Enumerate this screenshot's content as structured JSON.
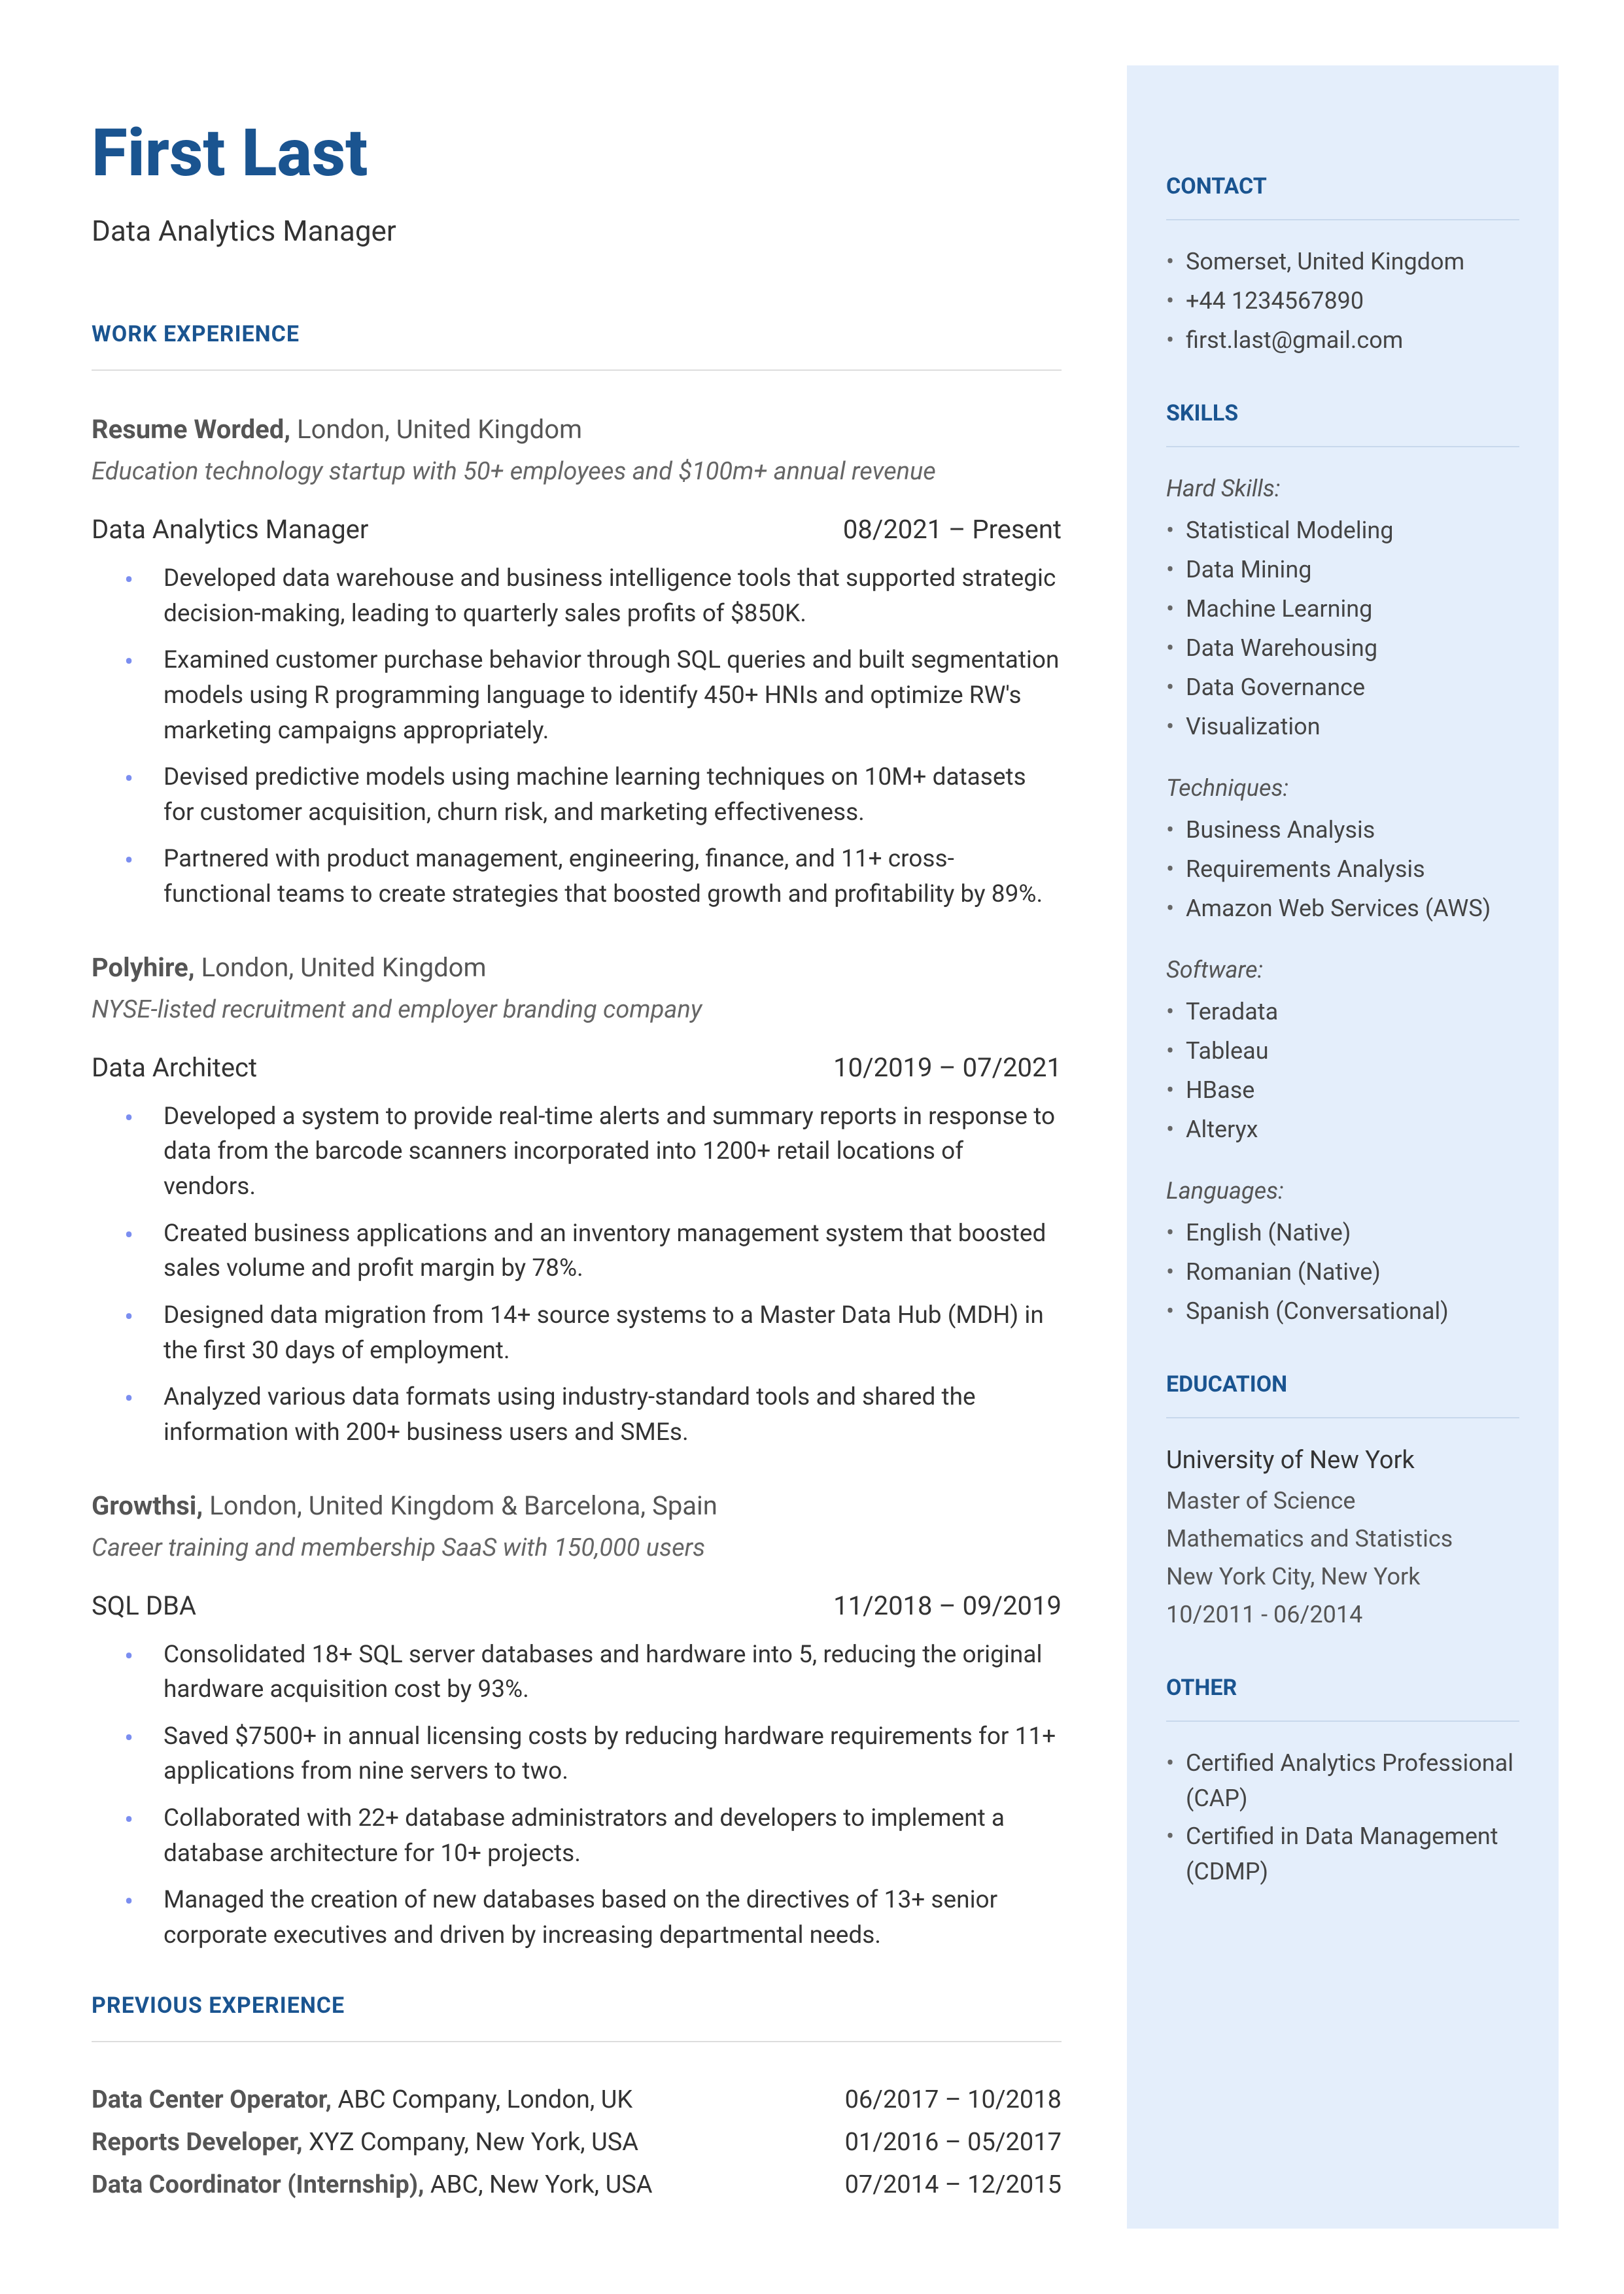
{
  "name": "First Last",
  "title": "Data Analytics Manager",
  "sections": {
    "work_experience": "WORK EXPERIENCE",
    "previous_experience": "PREVIOUS EXPERIENCE",
    "contact": "CONTACT",
    "skills": "SKILLS",
    "education": "EDUCATION",
    "other": "OTHER"
  },
  "jobs": [
    {
      "company": "Resume Worded,",
      "location": " London, United Kingdom",
      "desc": "Education technology startup with 50+ employees and $100m+ annual revenue",
      "role": "Data Analytics Manager",
      "dates": "08/2021 – Present",
      "bullets": [
        "Developed data warehouse and business intelligence tools that supported strategic decision-making, leading to quarterly sales profits of $850K.",
        "Examined customer purchase behavior through SQL queries and built segmentation models using R programming language to identify 450+ HNIs and optimize RW's marketing campaigns appropriately.",
        "Devised predictive models using machine learning techniques on 10M+ datasets for customer acquisition, churn risk, and marketing effectiveness.",
        "Partnered with product management, engineering, finance, and 11+ cross-functional teams to create strategies that boosted growth and profitability by 89%."
      ]
    },
    {
      "company": "Polyhire,",
      "location": " London, United Kingdom",
      "desc": "NYSE-listed recruitment and employer branding company",
      "role": "Data Architect",
      "dates": "10/2019 – 07/2021",
      "bullets": [
        "Developed a system to provide real-time alerts and summary reports in response to data from the barcode scanners incorporated into 1200+ retail locations of vendors.",
        "Created business applications and an inventory management system that boosted sales volume and profit margin by 78%.",
        "Designed data migration from 14+ source systems to a Master Data Hub (MDH) in the first 30 days of employment.",
        "Analyzed various data formats using industry-standard tools and shared the information with 200+ business users and SMEs."
      ]
    },
    {
      "company": "Growthsi,",
      "location": " London, United Kingdom & Barcelona, Spain",
      "desc": "Career training and membership SaaS with 150,000 users",
      "role": "SQL DBA",
      "dates": "11/2018 – 09/2019",
      "bullets": [
        "Consolidated 18+ SQL server databases and hardware into 5, reducing the original hardware acquisition cost by 93%.",
        "Saved $7500+ in annual licensing costs by reducing hardware requirements for 11+ applications from nine servers to two.",
        "Collaborated with 22+ database administrators and developers to implement a database architecture for 10+ projects.",
        "Managed the creation of new databases based on the directives of 13+ senior corporate executives and driven by increasing departmental needs."
      ]
    }
  ],
  "previous": [
    {
      "role": "Data Center Operator,",
      "rest": " ABC Company, London, UK",
      "dates": "06/2017 – 10/2018"
    },
    {
      "role": "Reports Developer,",
      "rest": " XYZ Company, New York, USA",
      "dates": "01/2016 – 05/2017"
    },
    {
      "role": "Data Coordinator (Internship),",
      "rest": " ABC, New York, USA",
      "dates": "07/2014 – 12/2015"
    }
  ],
  "contact": [
    "Somerset, United Kingdom",
    "+44 1234567890",
    "first.last@gmail.com"
  ],
  "skills": {
    "hard_label": "Hard Skills:",
    "hard": [
      "Statistical Modeling",
      "Data Mining",
      "Machine Learning",
      "Data Warehousing",
      "Data Governance",
      "Visualization"
    ],
    "tech_label": "Techniques:",
    "tech": [
      "Business Analysis",
      "Requirements Analysis",
      "Amazon Web Services (AWS)"
    ],
    "soft_label": "Software:",
    "soft": [
      "Teradata",
      "Tableau",
      "HBase",
      "Alteryx"
    ],
    "lang_label": "Languages:",
    "lang": [
      "English (Native)",
      "Romanian (Native)",
      "Spanish (Conversational)"
    ]
  },
  "education": {
    "school": "University of New York",
    "degree": "Master of Science",
    "field": "Mathematics and Statistics",
    "loc": "New York City, New York",
    "dates": "10/2011 - 06/2014"
  },
  "other": [
    "Certified Analytics Professional (CAP)",
    "Certified in Data Management (CDMP)"
  ]
}
